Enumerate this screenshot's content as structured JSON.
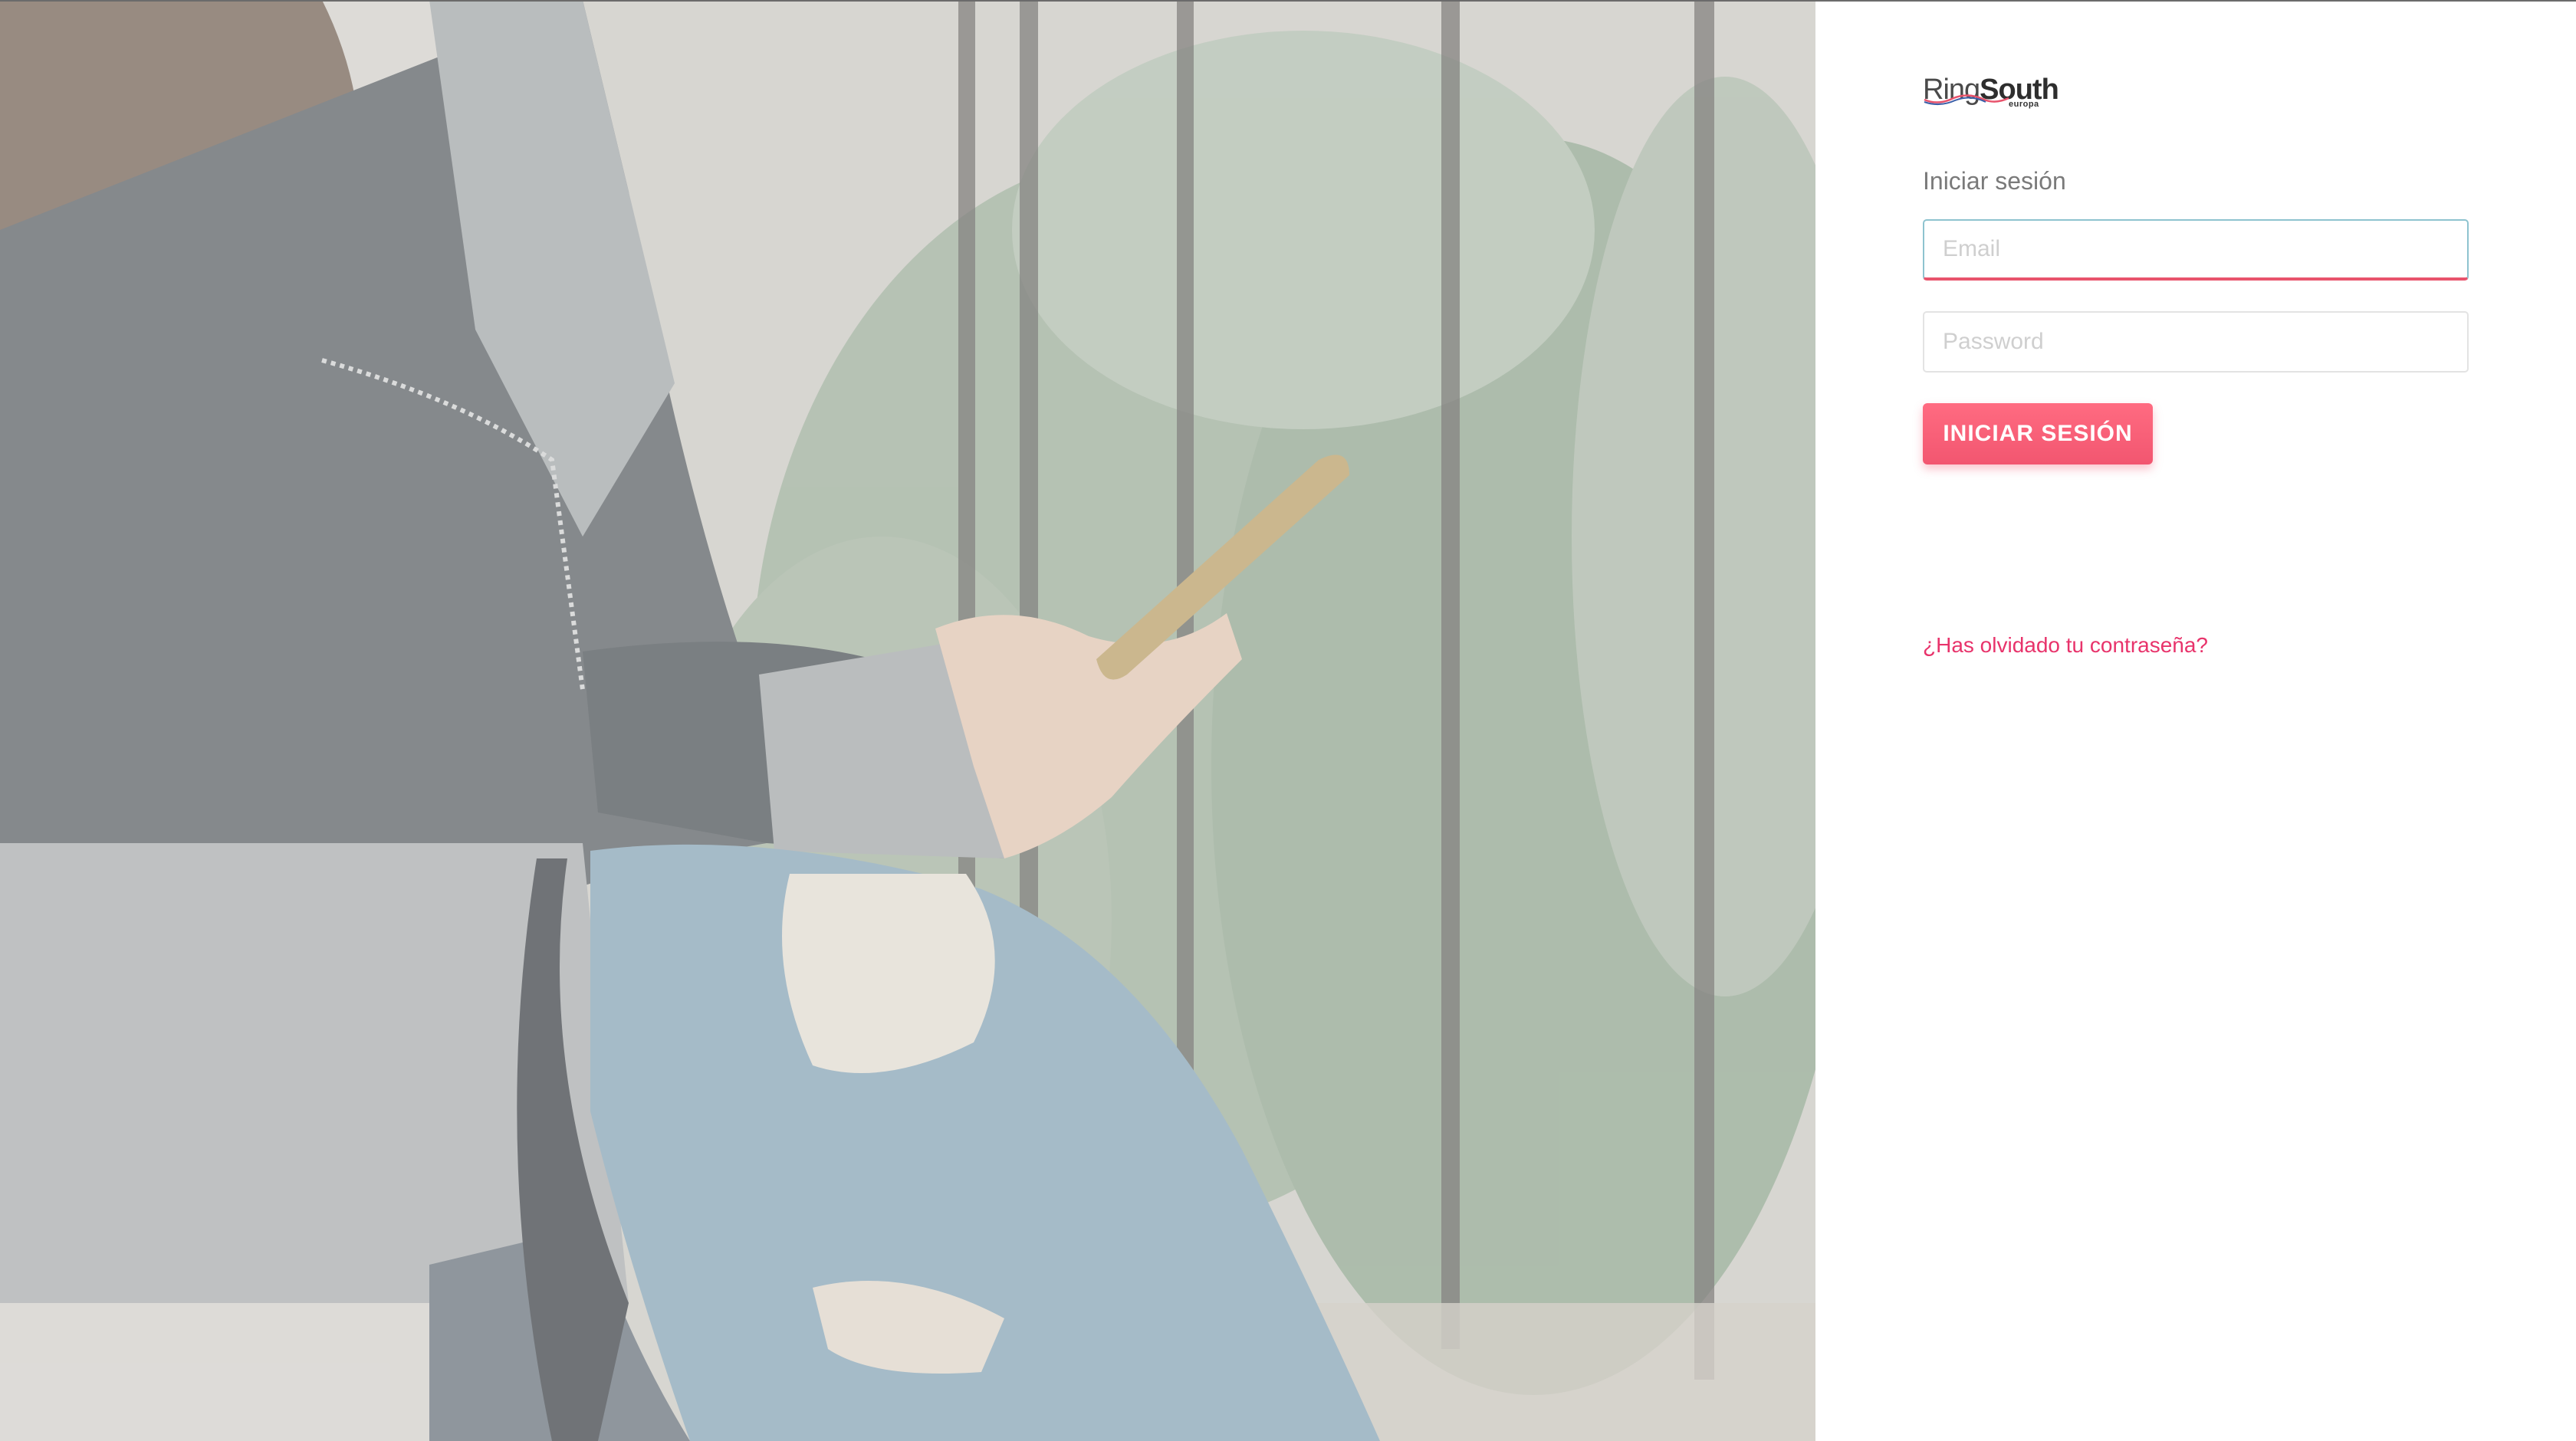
{
  "brand": {
    "logo_ring": "Ring",
    "logo_south": "South",
    "logo_sub": "europa"
  },
  "login": {
    "heading": "Iniciar sesión",
    "email_placeholder": "Email",
    "password_placeholder": "Password",
    "submit_label": "INICIAR SESIÓN",
    "forgot_link": "¿Has olvidado tu contraseña?"
  },
  "colors": {
    "accent": "#f25670",
    "link": "#e8336b",
    "focus_border": "#8ec3cf"
  }
}
